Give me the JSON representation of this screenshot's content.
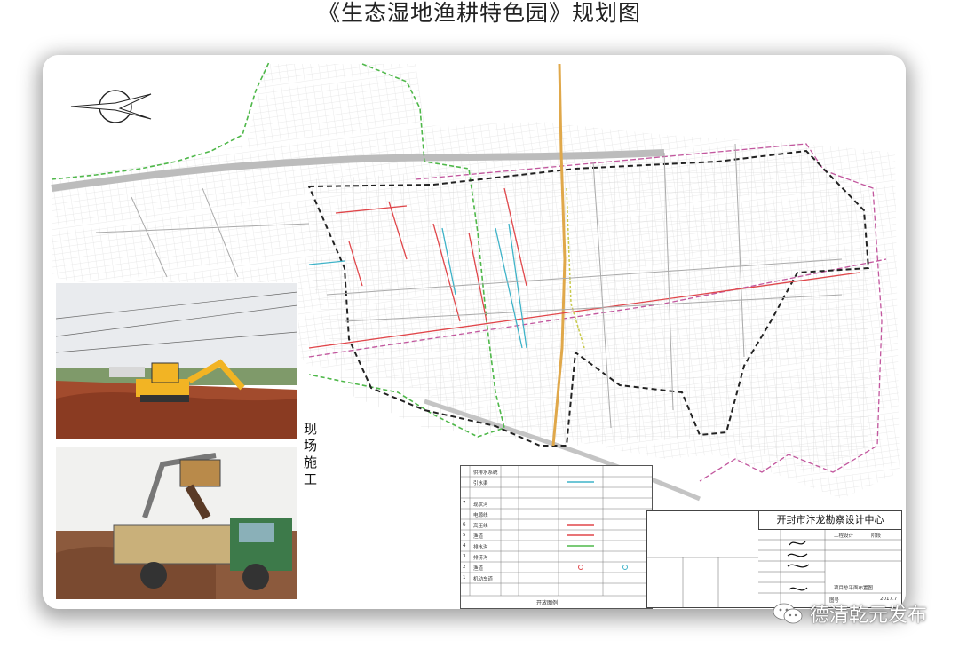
{
  "title": "《生态湿地渔耕特色园》规划图",
  "map": {
    "site_label": "现场施工",
    "compass_icon": "compass-rose-icon",
    "colors": {
      "boundary": "#222222",
      "green_dash": "#4fb84a",
      "magenta_dash": "#c2579e",
      "road_orange": "#e0a84a",
      "red_line": "#e0464a",
      "cyan_line": "#3fb3c8"
    }
  },
  "legend": {
    "row_numbers": [
      "7",
      "6",
      "5",
      "4",
      "3",
      "2",
      "1"
    ],
    "labels": [
      "供排水系统",
      "引水渠",
      "",
      "现状河",
      "电源线",
      "高压线",
      "渔道",
      "排水沟",
      "排涝沟",
      "渔道",
      "机动车道"
    ],
    "footer": "开放图例"
  },
  "title_block": {
    "organization": "开封市汴龙勘察设计中心",
    "stage_label": "工程设计",
    "stage_value": "阶段",
    "drawing_name": "项目总平面布置图",
    "drawing_no_label": "图号",
    "date": "2017.7"
  },
  "watermark": "德清乾元发布"
}
